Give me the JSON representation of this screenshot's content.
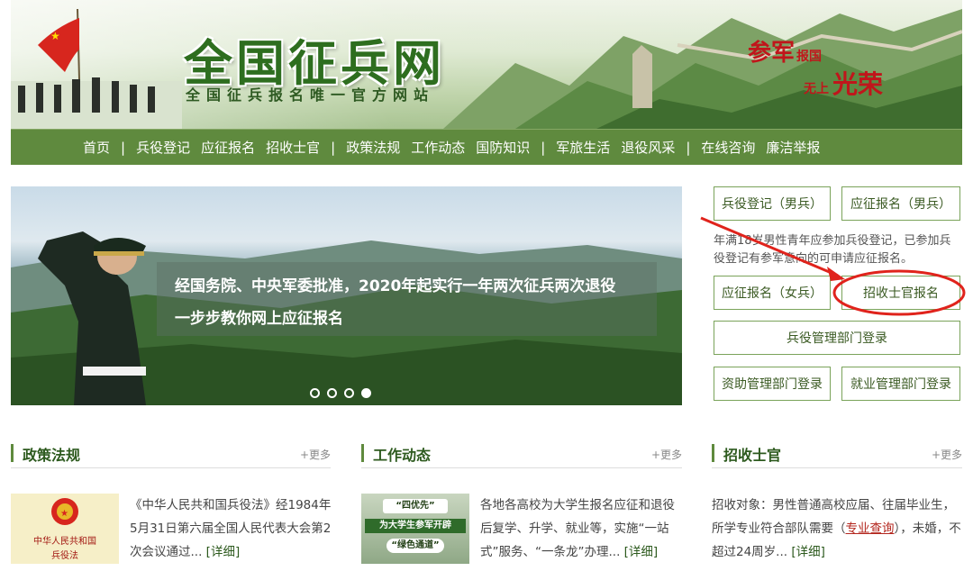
{
  "banner": {
    "title": "全国征兵网",
    "subtitle": "全国征兵报名唯一官方网站",
    "slogan_a": "参军",
    "slogan_a_small": "报国",
    "slogan_b_small": "无上",
    "slogan_b": "光荣"
  },
  "nav": {
    "items": [
      "首页",
      "兵役登记",
      "应征报名",
      "招收士官",
      "政策法规",
      "工作动态",
      "国防知识",
      "军旅生活",
      "退役风采",
      "在线咨询",
      "廉洁举报"
    ],
    "separator": "|"
  },
  "slider": {
    "caption_line1": "经国务院、中央军委批准，2020年起实行一年两次征兵两次退役",
    "caption_line2": "一步步教你网上应征报名",
    "dot_count": 4,
    "active_dot": 4
  },
  "panel": {
    "btn_register_male": "兵役登记（男兵）",
    "btn_apply_male": "应征报名（男兵）",
    "note": "年满18岁男性青年应参加兵役登记，已参加兵役登记有参军意向的可申请应征报名。",
    "btn_apply_female": "应征报名（女兵）",
    "btn_nco": "招收士官报名",
    "btn_admin_login": "兵役管理部门登录",
    "btn_aid_login": "资助管理部门登录",
    "btn_employ_login": "就业管理部门登录"
  },
  "sections": {
    "policy": {
      "title": "政策法规",
      "more": "+更多",
      "thumb_line1": "中华人民共和国",
      "thumb_line2": "兵役法",
      "text": "《中华人民共和国兵役法》经1984年5月31日第六届全国人民代表大会第2次会议通过...",
      "detail": "[详细]"
    },
    "work": {
      "title": "工作动态",
      "more": "+更多",
      "thumb_line1": "“四优先”",
      "thumb_line2": "为大学生参军开辟",
      "thumb_line3": "“绿色通道”",
      "text": "各地各高校为大学生报名应征和退役后复学、升学、就业等，实施“一站式”服务、“一条龙”办理...",
      "detail": "[详细]"
    },
    "nco": {
      "title": "招收士官",
      "more": "+更多",
      "text_a": "招收对象：男性普通高校应届、往届毕业生，所学专业符合部队需要（",
      "link": "专业查询",
      "text_b": "），未婚，不超过24周岁...",
      "detail": "[详细]"
    }
  },
  "colors": {
    "brand_green": "#5f8a3e",
    "title_green": "#2e6e1f",
    "annotation_red": "#e0231c"
  }
}
